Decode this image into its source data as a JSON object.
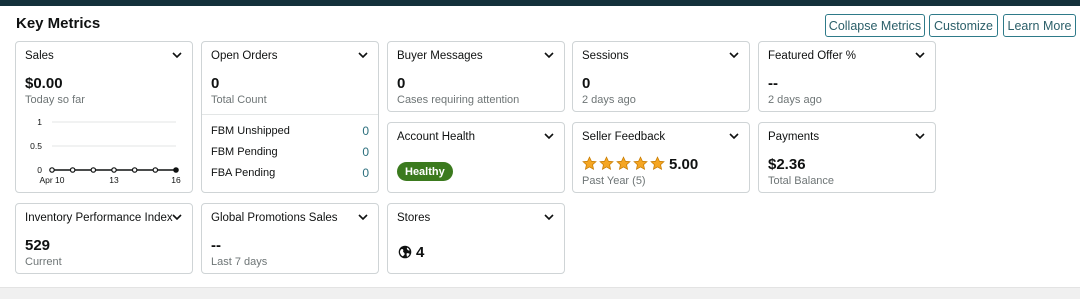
{
  "header": {
    "title": "Key Metrics",
    "buttons": [
      "Collapse Metrics",
      "Customize",
      "Learn More"
    ]
  },
  "cards": {
    "sales": {
      "title": "Sales",
      "value": "$0.00",
      "sub": "Today so far",
      "chart_data": {
        "type": "line",
        "x_ticks": [
          "Apr 10",
          "13",
          "16"
        ],
        "y_ticks": [
          "1",
          "0.5",
          "0"
        ],
        "ylim": [
          0,
          1
        ],
        "values": [
          0,
          0,
          0,
          0,
          0,
          0,
          0
        ]
      }
    },
    "open_orders": {
      "title": "Open Orders",
      "value": "0",
      "sub": "Total Count",
      "rows": [
        {
          "label": "FBM Unshipped",
          "value": "0"
        },
        {
          "label": "FBM Pending",
          "value": "0"
        },
        {
          "label": "FBA Pending",
          "value": "0"
        }
      ]
    },
    "buyer_messages": {
      "title": "Buyer Messages",
      "value": "0",
      "sub": "Cases requiring attention"
    },
    "sessions": {
      "title": "Sessions",
      "value": "0",
      "sub": "2 days ago"
    },
    "featured_offer": {
      "title": "Featured Offer %",
      "value": "--",
      "sub": "2 days ago"
    },
    "account_health": {
      "title": "Account Health",
      "badge": "Healthy",
      "badge_color": "#3b7a1e"
    },
    "seller_feedback": {
      "title": "Seller Feedback",
      "rating": "5.00",
      "stars": 5,
      "sub": "Past Year (5)"
    },
    "payments": {
      "title": "Payments",
      "value": "$2.36",
      "sub": "Total Balance"
    },
    "inventory": {
      "title": "Inventory Performance Index",
      "value": "529",
      "sub": "Current"
    },
    "global_promotions": {
      "title": "Global Promotions Sales",
      "value": "--",
      "sub": "Last 7 days"
    },
    "stores": {
      "title": "Stores",
      "value": "4",
      "icon": "globe-icon"
    }
  }
}
